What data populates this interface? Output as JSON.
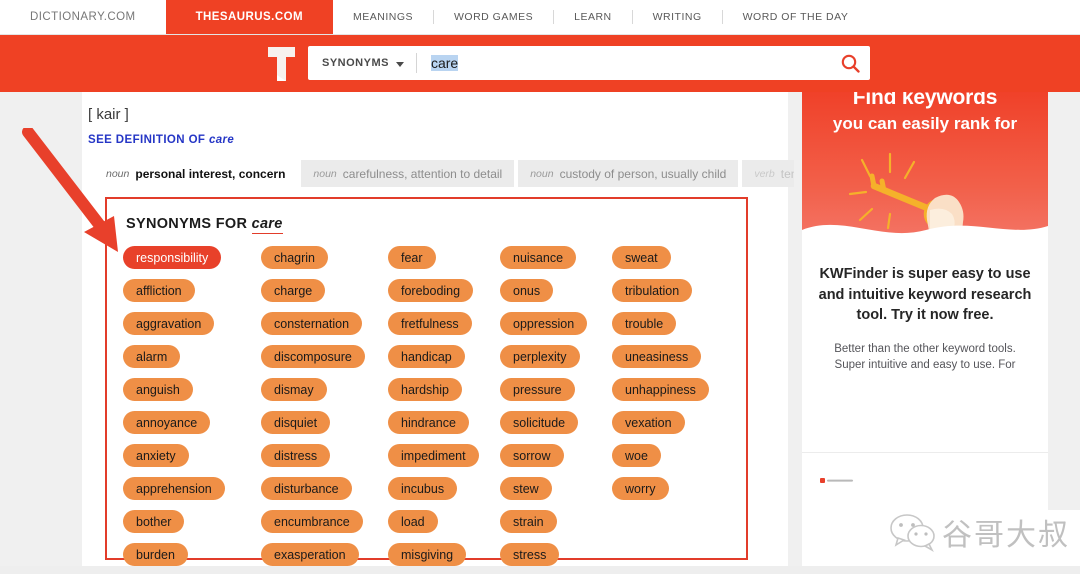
{
  "topnav": {
    "brand_tabs": [
      {
        "label": "DICTIONARY.COM",
        "active": false
      },
      {
        "label": "THESAURUS.COM",
        "active": true
      }
    ],
    "links": [
      "MEANINGS",
      "WORD GAMES",
      "LEARN",
      "WRITING",
      "WORD OF THE DAY"
    ]
  },
  "search": {
    "logo_name": "thesaurus-t-logo",
    "select_label": "SYNONYMS",
    "query": "care",
    "placeholder": "",
    "search_icon": "search-icon",
    "band_color": "#ef4124"
  },
  "word": {
    "pronunciation": "[ kair ]",
    "see_definition_prefix": "SEE DEFINITION OF",
    "see_definition_word": "care",
    "see_definition_color": "#2536c6"
  },
  "pos_tabs": [
    {
      "pos": "noun",
      "sense": "personal interest, concern",
      "active": true,
      "faded": false
    },
    {
      "pos": "noun",
      "sense": "carefulness, attention to detail",
      "active": false,
      "faded": false
    },
    {
      "pos": "noun",
      "sense": "custody of person, usually child",
      "active": false,
      "faded": false
    },
    {
      "pos": "verb",
      "sense": "ten",
      "active": false,
      "faded": true
    }
  ],
  "pos_tabs_next_icon": "chevron-right-icon",
  "synonyms": {
    "heading_prefix": "SYNONYMS FOR",
    "heading_word": "care",
    "highlight_color": "#e23c2a",
    "chip_color": "#ef8f46",
    "chip_active_color": "#e8412a",
    "columns": [
      {
        "items": [
          {
            "label": "responsibility",
            "highlighted": true
          },
          {
            "label": "affliction",
            "highlighted": false
          },
          {
            "label": "aggravation",
            "highlighted": false
          },
          {
            "label": "alarm",
            "highlighted": false
          },
          {
            "label": "anguish",
            "highlighted": false
          },
          {
            "label": "annoyance",
            "highlighted": false
          },
          {
            "label": "anxiety",
            "highlighted": false
          },
          {
            "label": "apprehension",
            "highlighted": false
          },
          {
            "label": "bother",
            "highlighted": false
          },
          {
            "label": "burden",
            "highlighted": false
          }
        ]
      },
      {
        "items": [
          {
            "label": "chagrin",
            "highlighted": false
          },
          {
            "label": "charge",
            "highlighted": false
          },
          {
            "label": "consternation",
            "highlighted": false
          },
          {
            "label": "discomposure",
            "highlighted": false
          },
          {
            "label": "dismay",
            "highlighted": false
          },
          {
            "label": "disquiet",
            "highlighted": false
          },
          {
            "label": "distress",
            "highlighted": false
          },
          {
            "label": "disturbance",
            "highlighted": false
          },
          {
            "label": "encumbrance",
            "highlighted": false
          },
          {
            "label": "exasperation",
            "highlighted": false
          }
        ]
      },
      {
        "items": [
          {
            "label": "fear",
            "highlighted": false
          },
          {
            "label": "foreboding",
            "highlighted": false
          },
          {
            "label": "fretfulness",
            "highlighted": false
          },
          {
            "label": "handicap",
            "highlighted": false
          },
          {
            "label": "hardship",
            "highlighted": false
          },
          {
            "label": "hindrance",
            "highlighted": false
          },
          {
            "label": "impediment",
            "highlighted": false
          },
          {
            "label": "incubus",
            "highlighted": false
          },
          {
            "label": "load",
            "highlighted": false
          },
          {
            "label": "misgiving",
            "highlighted": false
          }
        ]
      },
      {
        "items": [
          {
            "label": "nuisance",
            "highlighted": false
          },
          {
            "label": "onus",
            "highlighted": false
          },
          {
            "label": "oppression",
            "highlighted": false
          },
          {
            "label": "perplexity",
            "highlighted": false
          },
          {
            "label": "pressure",
            "highlighted": false
          },
          {
            "label": "solicitude",
            "highlighted": false
          },
          {
            "label": "sorrow",
            "highlighted": false
          },
          {
            "label": "stew",
            "highlighted": false
          },
          {
            "label": "strain",
            "highlighted": false
          },
          {
            "label": "stress",
            "highlighted": false
          }
        ]
      },
      {
        "items": [
          {
            "label": "sweat",
            "highlighted": false
          },
          {
            "label": "tribulation",
            "highlighted": false
          },
          {
            "label": "trouble",
            "highlighted": false
          },
          {
            "label": "uneasiness",
            "highlighted": false
          },
          {
            "label": "unhappiness",
            "highlighted": false
          },
          {
            "label": "vexation",
            "highlighted": false
          },
          {
            "label": "woe",
            "highlighted": false
          },
          {
            "label": "worry",
            "highlighted": false
          }
        ]
      }
    ]
  },
  "ad": {
    "headline_line1": "Find keywords",
    "headline_line2": "you can easily rank for",
    "art_name": "hand-holding-key-illustration",
    "tagline": "KWFinder is super easy to use and intuitive keyword research tool. Try it now free.",
    "subtext": "Better than the other keyword tools. Super intuitive and easy to use. For",
    "accent_color": "#f04129",
    "key_color": "#f5b12a",
    "sleeve_color": "#1e41c8"
  },
  "annotation": {
    "arrow_name": "red-annotation-arrow",
    "arrow_color": "#e8402b"
  },
  "watermark": {
    "icon_name": "wechat-icon",
    "text": "谷哥大叔"
  }
}
